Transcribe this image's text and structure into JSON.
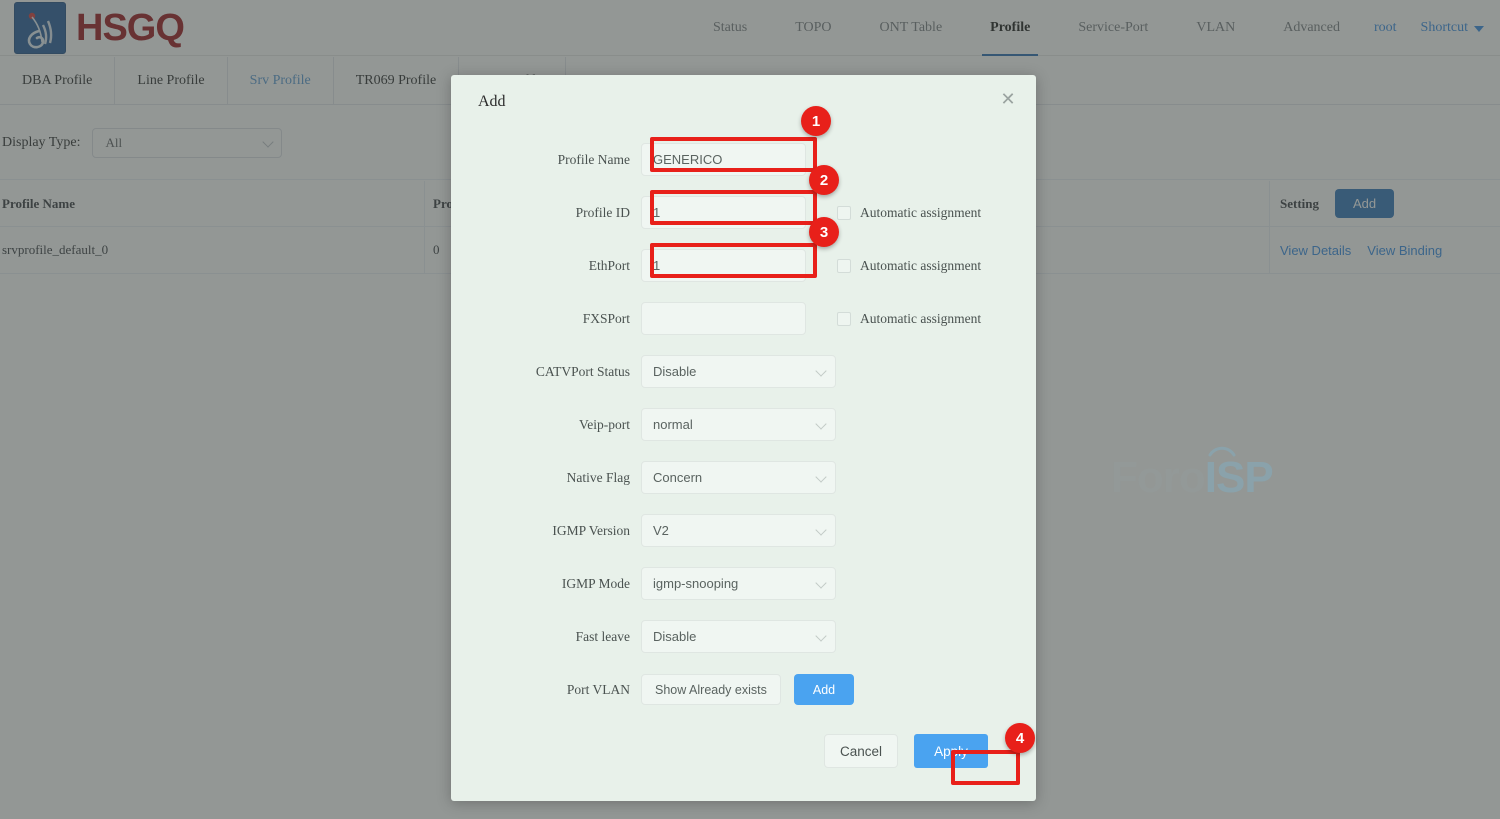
{
  "brand": {
    "name": "HSGQ",
    "logo_icon": "water-droplet-swirl-logo"
  },
  "topnav": {
    "items": [
      {
        "label": "Status",
        "active": false
      },
      {
        "label": "TOPO",
        "active": false
      },
      {
        "label": "ONT Table",
        "active": false
      },
      {
        "label": "Profile",
        "active": true
      },
      {
        "label": "Service-Port",
        "active": false
      },
      {
        "label": "VLAN",
        "active": false
      },
      {
        "label": "Advanced",
        "active": false
      }
    ],
    "user": "root",
    "shortcut": "Shortcut"
  },
  "subtabs": [
    {
      "label": "DBA Profile",
      "active": false
    },
    {
      "label": "Line Profile",
      "active": false
    },
    {
      "label": "Srv Profile",
      "active": true
    },
    {
      "label": "TR069 Profile",
      "active": false
    },
    {
      "label": "SIP Profile",
      "active": false
    }
  ],
  "filter": {
    "label": "Display Type:",
    "value": "All"
  },
  "table": {
    "headers": {
      "col1": "Profile Name",
      "col2": "Prof",
      "col3": "Setting"
    },
    "add_button": "Add",
    "rows": [
      {
        "profile_name": "srvprofile_default_0",
        "profile_id": "0",
        "link_details": "View Details",
        "link_binding": "View Binding"
      }
    ]
  },
  "watermark": {
    "part1": "Foro",
    "part2": "ISP"
  },
  "modal": {
    "title": "Add",
    "close_icon": "close-icon",
    "fields": {
      "profile_name": {
        "label": "Profile Name",
        "value": "GENERICO"
      },
      "profile_id": {
        "label": "Profile ID",
        "value": "1",
        "checkbox": "Automatic assignment",
        "checked": false
      },
      "ethport": {
        "label": "EthPort",
        "value": "1",
        "checkbox": "Automatic assignment",
        "checked": false
      },
      "fxsport": {
        "label": "FXSPort",
        "value": "",
        "checkbox": "Automatic assignment",
        "checked": false
      },
      "catvport_status": {
        "label": "CATVPort Status",
        "value": "Disable"
      },
      "veip_port": {
        "label": "Veip-port",
        "value": "normal"
      },
      "native_flag": {
        "label": "Native Flag",
        "value": "Concern"
      },
      "igmp_version": {
        "label": "IGMP Version",
        "value": "V2"
      },
      "igmp_mode": {
        "label": "IGMP Mode",
        "value": "igmp-snooping"
      },
      "fast_leave": {
        "label": "Fast leave",
        "value": "Disable"
      },
      "port_vlan": {
        "label": "Port VLAN",
        "show_button": "Show Already exists",
        "add_button": "Add"
      }
    },
    "footer": {
      "cancel": "Cancel",
      "apply": "Apply"
    }
  },
  "annotations": {
    "accent_color": "#e8201a",
    "steps": [
      {
        "number": "1",
        "target": "profile-name-input"
      },
      {
        "number": "2",
        "target": "profile-id-input"
      },
      {
        "number": "3",
        "target": "ethport-input"
      },
      {
        "number": "4",
        "target": "apply-button"
      }
    ]
  }
}
